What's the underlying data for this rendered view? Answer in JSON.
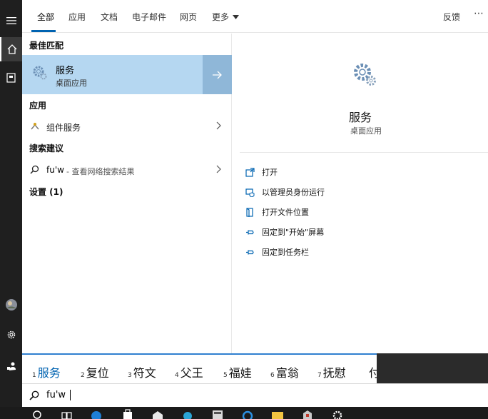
{
  "tabs": {
    "items": [
      "全部",
      "应用",
      "文档",
      "电子邮件",
      "网页",
      "更多"
    ],
    "feedback": "反馈",
    "more_icon": "ellipsis-icon"
  },
  "left": {
    "best_match_title": "最佳匹配",
    "best_match": {
      "name": "服务",
      "subtitle": "桌面应用"
    },
    "apps_title": "应用",
    "apps": [
      {
        "name": "组件服务"
      }
    ],
    "search_suggest_title": "搜索建议",
    "search_suggest": {
      "query": "fu'w",
      "suffix": " - 查看网络搜索结果"
    },
    "settings_title": "设置 (1)"
  },
  "preview": {
    "name": "服务",
    "subtitle": "桌面应用",
    "actions": [
      "打开",
      "以管理员身份运行",
      "打开文件位置",
      "固定到\"开始\"屏幕",
      "固定到任务栏"
    ]
  },
  "ime": {
    "candidates": [
      {
        "num": "1",
        "text": "服务"
      },
      {
        "num": "2",
        "text": "复位"
      },
      {
        "num": "3",
        "text": "符文"
      },
      {
        "num": "4",
        "text": "父王"
      },
      {
        "num": "5",
        "text": "福娃"
      },
      {
        "num": "6",
        "text": "富翁"
      },
      {
        "num": "7",
        "text": "抚慰"
      },
      {
        "num": "",
        "text": "付"
      }
    ]
  },
  "search": {
    "value": "fu'w"
  },
  "colors": {
    "accent": "#0063b1",
    "selected_bg": "#b5d7f1",
    "rail": "#1f1f1f"
  }
}
